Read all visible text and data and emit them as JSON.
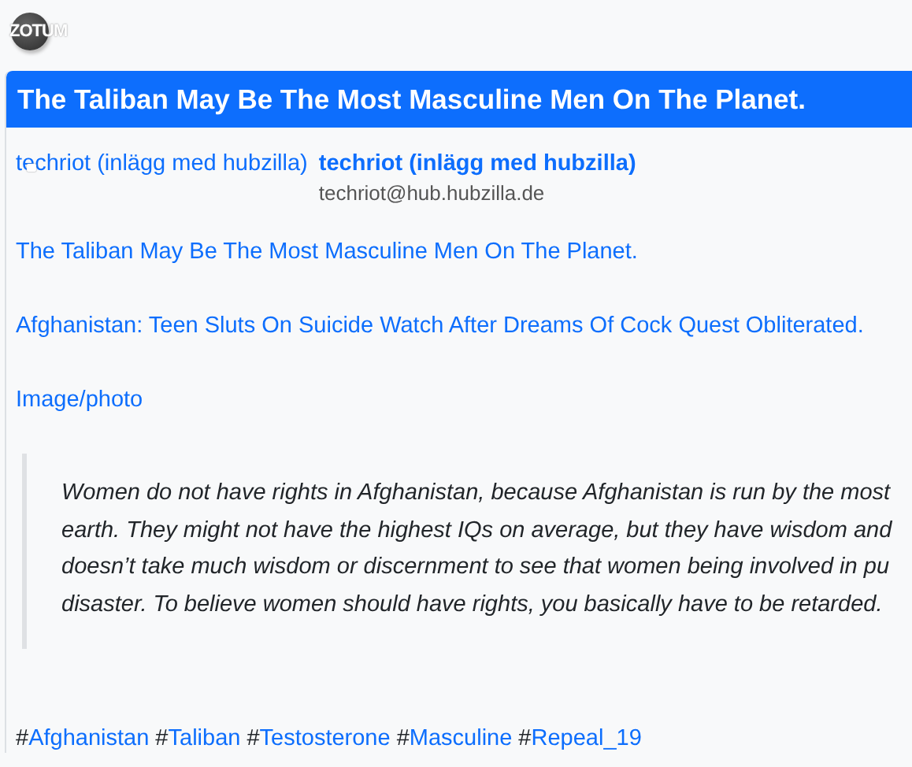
{
  "logo": "ZOTUM",
  "post": {
    "title": "The Taliban May Be The Most Masculine Men On The Planet.",
    "avatar_alt": "techriot (inlägg med hubzilla)",
    "author": "techriot (inlägg med hubzilla)",
    "address": "techriot@hub.hubzilla.de",
    "links": [
      "The Taliban May Be The Most Masculine Men On The Planet.",
      "Afghanistan: Teen Sluts On Suicide Watch After Dreams Of Cock Quest Obliterated.",
      "Image/photo"
    ],
    "quote_lines": [
      "Women do not have rights in Afghanistan, because Afghanistan is run by the most",
      "earth. They might not have the highest IQs on average, but they have wisdom and",
      "doesn’t take much wisdom or discernment to see that women being involved in pu",
      "disaster. To believe women should have rights, you basically have to be retarded."
    ],
    "tags": [
      {
        "prefix": "#",
        "label": "Afghanistan"
      },
      {
        "prefix": "#",
        "label": "Taliban"
      },
      {
        "prefix": "#",
        "label": "Testosterone"
      },
      {
        "prefix": "#",
        "label": "Masculine"
      },
      {
        "prefix": "#",
        "label": "Repeal_19"
      }
    ]
  }
}
